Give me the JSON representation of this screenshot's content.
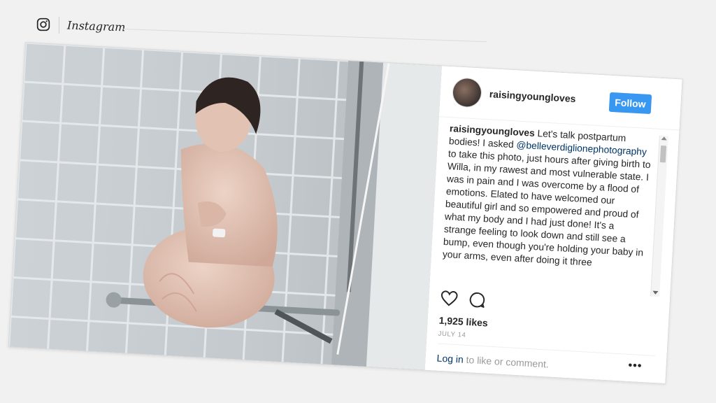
{
  "header": {
    "brand": "Instagram"
  },
  "post": {
    "username": "raisingyoungloves",
    "follow_label": "Follow",
    "caption": {
      "user": "raisingyoungloves",
      "text_before_mention": " Let's talk postpartum bodies! I asked ",
      "mention": "@belleverdiglionephotography",
      "text_after_mention": " to take this photo, just hours after giving birth to Willa, in my rawest and most vulnerable state. I was in pain and I was overcome by a flood of emotions. Elated to have welcomed our beautiful girl and so empowered and proud of what my body and I had just done! It's a strange feeling to look down and still see a bump, even though you're holding your baby in your arms, even after doing it three"
    },
    "likes": "1,925 likes",
    "date": "JULY 14",
    "login_link": "Log in",
    "login_rest": " to like or comment.",
    "more": "•••"
  },
  "icons": {
    "brand": "instagram-glyph-icon",
    "like": "heart-icon",
    "comment": "comment-bubble-icon"
  },
  "colors": {
    "follow_button": "#3897f0",
    "link": "#003569",
    "muted": "#999999"
  }
}
